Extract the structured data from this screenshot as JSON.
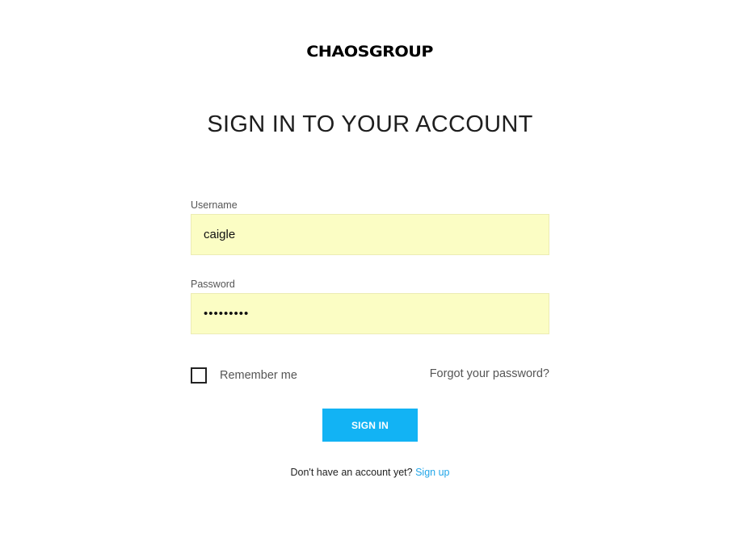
{
  "brand": {
    "logo_text": "CHAOSGROUP"
  },
  "page": {
    "heading": "SIGN IN TO YOUR ACCOUNT"
  },
  "form": {
    "username": {
      "label": "Username",
      "value": "caigle"
    },
    "password": {
      "label": "Password",
      "value": "abcdefghi"
    },
    "remember_me": {
      "label": "Remember me",
      "checked": false
    },
    "forgot_password_link": "Forgot your password?",
    "submit_label": "SIGN IN"
  },
  "footer": {
    "prompt": "Don't have an account yet?",
    "signup_link": "Sign up"
  },
  "colors": {
    "accent": "#12b3f4",
    "link": "#22a6e8",
    "autofill_bg": "#fbfdc4"
  }
}
